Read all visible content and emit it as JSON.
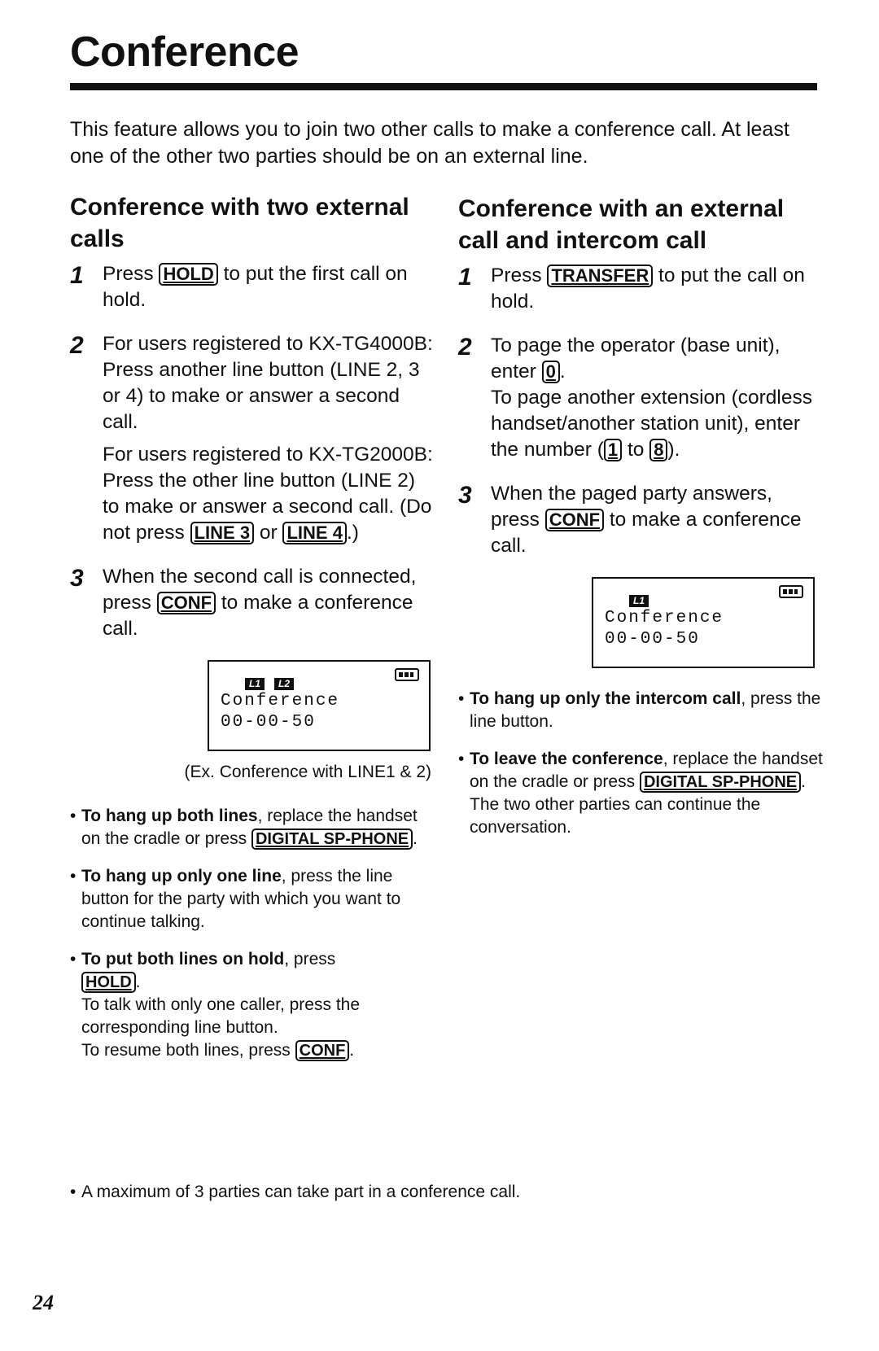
{
  "page": {
    "title": "Conference",
    "intro": "This feature allows you to join two other calls to make a conference call. At least one of the other two parties should be on an external line.",
    "page_number": "24"
  },
  "left": {
    "heading": "Conference with two external calls",
    "step1": {
      "num": "1",
      "pre": "Press ",
      "key": "HOLD",
      "post": " to put the first call on hold."
    },
    "step2": {
      "num": "2",
      "p1": "For users registered to KX-TG4000B:",
      "p2": "Press another line button (LINE 2, 3 or 4) to make or answer a second call.",
      "p3": "For users registered to KX-TG2000B:",
      "p4_pre": "Press the other line button (LINE 2) to make or answer a second call. (Do not press ",
      "key_a": "LINE 3",
      "p4_mid": " or ",
      "key_b": "LINE 4",
      "p4_post": ".)"
    },
    "step3": {
      "num": "3",
      "pre": "When the second call is connected, press ",
      "key": "CONF",
      "post": " to make a conference call."
    },
    "lcd": {
      "badges": [
        "L1",
        "L2"
      ],
      "line1": "Conference",
      "line2": "00-00-50"
    },
    "caption": "(Ex. Conference with LINE1 & 2)",
    "bullets": [
      {
        "bold": "To hang up both lines",
        "text": ", replace the handset on the cradle or press ",
        "key": "DIGITAL SP-PHONE",
        "after": "."
      },
      {
        "bold": "To hang up only one line",
        "text": ", press the line button for the party with which you want to continue talking."
      },
      {
        "bold": "To put both lines on hold",
        "text": ", press ",
        "key": "HOLD",
        "after": ".",
        "extra1": "To talk with only one caller, press the corresponding line button.",
        "extra2_pre": "To resume both lines, press ",
        "extra2_key": "CONF",
        "extra2_post": "."
      }
    ]
  },
  "right": {
    "heading": "Conference with an external call and intercom call",
    "step1": {
      "num": "1",
      "pre": "Press ",
      "key": "TRANSFER",
      "post": " to put the call on hold."
    },
    "step2": {
      "num": "2",
      "p1_pre": "To page the operator (base unit), enter ",
      "key0": "0",
      "p1_post": ".",
      "p2_pre": "To page another extension (cordless handset/another station unit), enter the number (",
      "key1": "1",
      "p2_mid": " to ",
      "key8": "8",
      "p2_post": ")."
    },
    "step3": {
      "num": "3",
      "pre": "When the paged party answers, press ",
      "key": "CONF",
      "post": " to make a conference call."
    },
    "lcd": {
      "badges": [
        "L1"
      ],
      "line1": "Conference",
      "line2": "00-00-50"
    },
    "bullets": [
      {
        "bold": "To hang up only the intercom call",
        "text": ", press the line button."
      },
      {
        "bold": "To leave the conference",
        "text": ", replace the handset on the cradle or press ",
        "key": "DIGITAL SP-PHONE",
        "after": ". The two other parties can continue the conversation."
      }
    ]
  },
  "footer_note": "A maximum of 3 parties can take part in a conference call."
}
